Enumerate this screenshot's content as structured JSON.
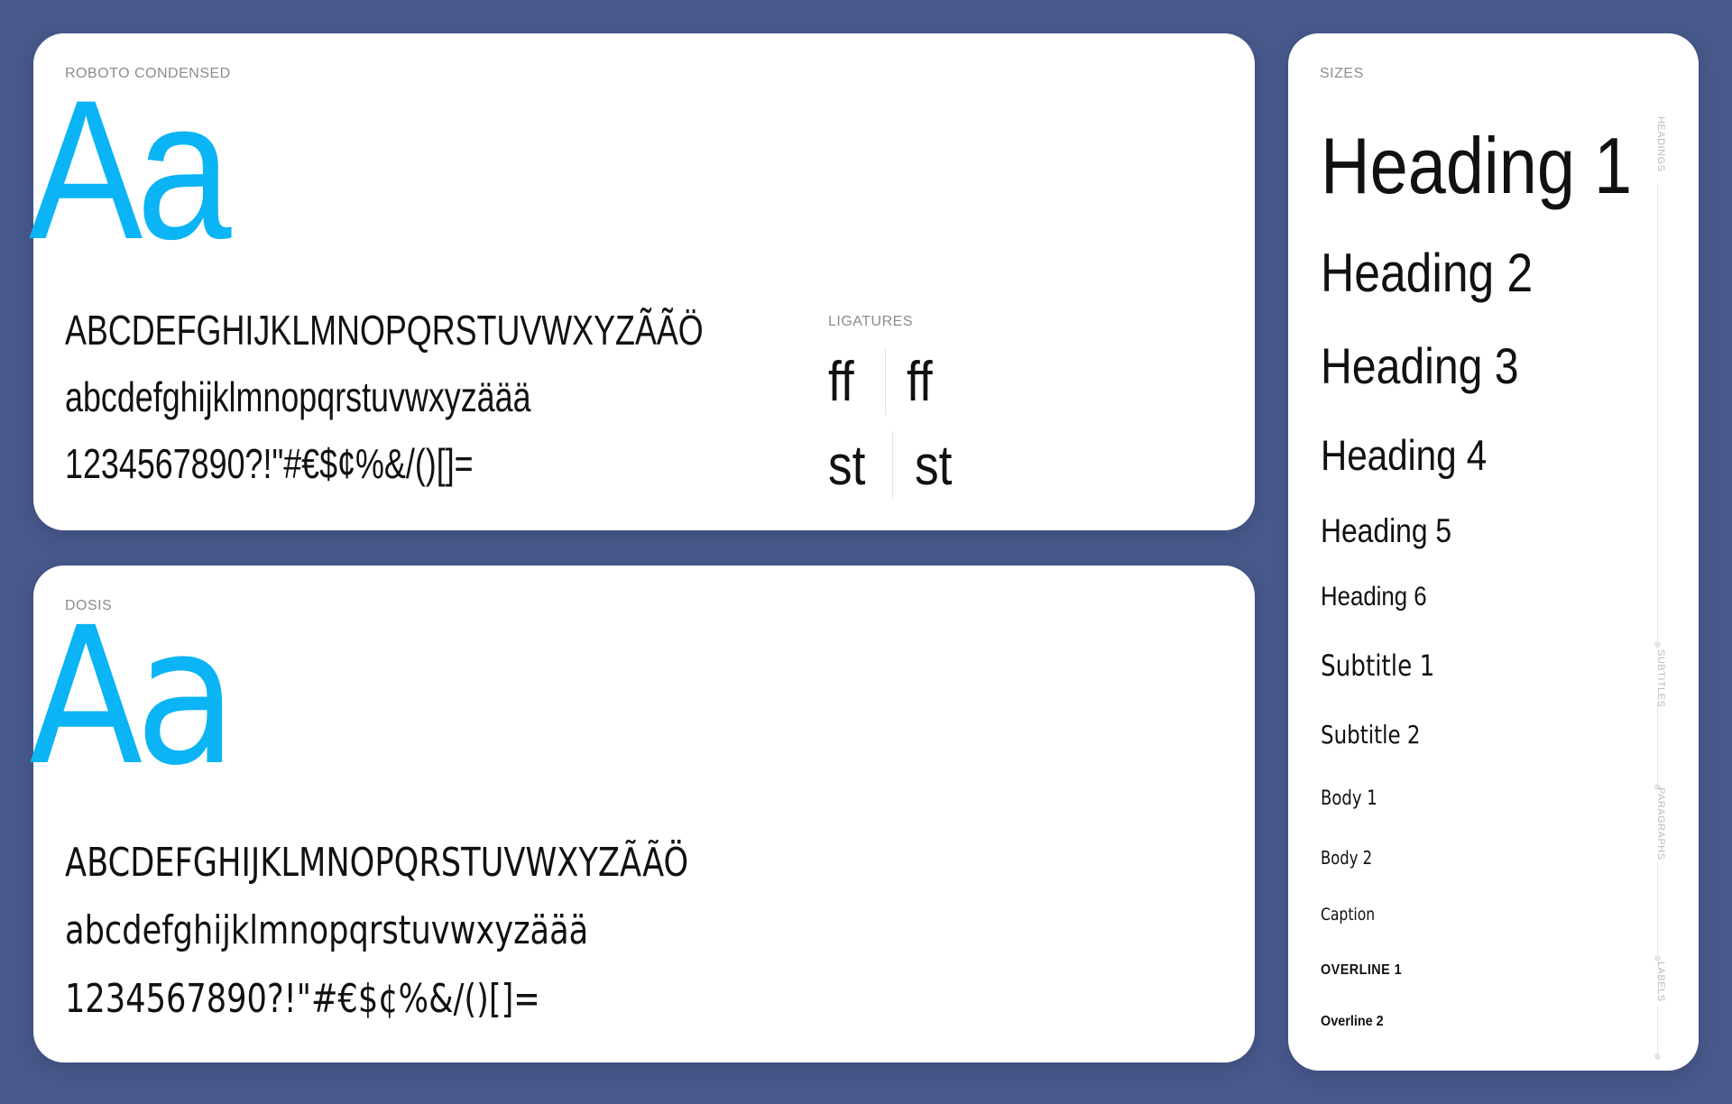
{
  "roboto_card": {
    "label": "ROBOTO CONDENSED",
    "specimen": "Aa",
    "uppercase": "ABCDEFGHIJKLMNOPQRSTUVWXYZÃÃÖ",
    "lowercase": "abcdefghijklmnopqrstuvwxyzäää",
    "numbers": "1234567890?!\"#€$¢%&/()[]=",
    "ligatures": {
      "label": "LIGATURES",
      "pairs": [
        {
          "plain": "ff",
          "ligated": "ff"
        },
        {
          "plain": "st",
          "ligated": "st"
        }
      ]
    }
  },
  "dosis_card": {
    "label": "DOSIS",
    "specimen": "Aa",
    "uppercase": "ABCDEFGHIJKLMNOPQRSTUVWXYZÃÃÖ",
    "lowercase": "abcdefghijklmnopqrstuvwxyzäää",
    "numbers": "1234567890?!\"#€$¢%&/()[]="
  },
  "sizes_card": {
    "label": "SIZES",
    "items": [
      "Heading 1",
      "Heading 2",
      "Heading 3",
      "Heading 4",
      "Heading 5",
      "Heading 6",
      "Subtitle 1",
      "Subtitle 2",
      "Body 1",
      "Body 2",
      "Caption",
      "OVERLINE 1",
      "Overline 2"
    ],
    "rail_groups": [
      "HEADINGS",
      "SUBTITLES",
      "PARAGRAPHS",
      "LABELS"
    ]
  },
  "colors": {
    "background": "#47588a",
    "card": "#ffffff",
    "accent": "#0ab4f5",
    "text": "#111111",
    "muted": "#8c8c8c"
  }
}
